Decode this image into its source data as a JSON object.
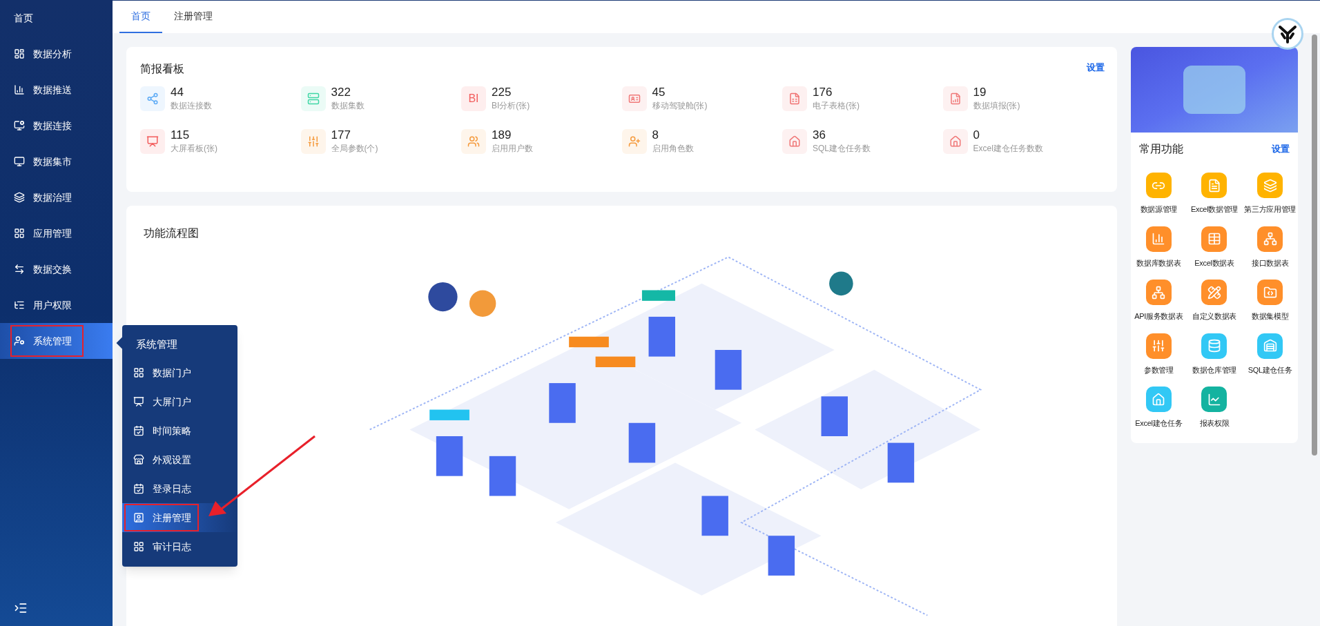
{
  "sidebar": {
    "home": "首页",
    "items": [
      {
        "label": "数据分析",
        "selected": false,
        "highlighted": false
      },
      {
        "label": "数据推送",
        "selected": false,
        "highlighted": false
      },
      {
        "label": "数据连接",
        "selected": false,
        "highlighted": false
      },
      {
        "label": "数据集市",
        "selected": false,
        "highlighted": false
      },
      {
        "label": "数据治理",
        "selected": false,
        "highlighted": false
      },
      {
        "label": "应用管理",
        "selected": false,
        "highlighted": false
      },
      {
        "label": "数据交换",
        "selected": false,
        "highlighted": false
      },
      {
        "label": "用户权限",
        "selected": false,
        "highlighted": false
      },
      {
        "label": "系统管理",
        "selected": true,
        "highlighted": true
      }
    ]
  },
  "submenu": {
    "title": "系统管理",
    "items": [
      {
        "label": "数据门户",
        "selected": false,
        "highlighted": false
      },
      {
        "label": "大屏门户",
        "selected": false,
        "highlighted": false
      },
      {
        "label": "时间策略",
        "selected": false,
        "highlighted": false
      },
      {
        "label": "外观设置",
        "selected": false,
        "highlighted": false
      },
      {
        "label": "登录日志",
        "selected": false,
        "highlighted": false
      },
      {
        "label": "注册管理",
        "selected": true,
        "highlighted": true
      },
      {
        "label": "审计日志",
        "selected": false,
        "highlighted": false
      }
    ]
  },
  "tabs": [
    {
      "label": "首页",
      "selected": true
    },
    {
      "label": "注册管理",
      "selected": false
    }
  ],
  "summary": {
    "title": "简报看板",
    "action": "设置",
    "stats": [
      {
        "value": "44",
        "label": "数据连接数",
        "color": "#5aa9f5"
      },
      {
        "value": "322",
        "label": "数据集数",
        "color": "#3fd6a5"
      },
      {
        "value": "225",
        "label": "BI分析(张)",
        "color": "#f25c5c",
        "icon_text": "BI"
      },
      {
        "value": "45",
        "label": "移动驾驶舱(张)",
        "color": "#f07878"
      },
      {
        "value": "176",
        "label": "电子表格(张)",
        "color": "#f07070"
      },
      {
        "value": "19",
        "label": "数据填报(张)",
        "color": "#f07878"
      },
      {
        "value": "115",
        "label": "大屏看板(张)",
        "color": "#f25c5c"
      },
      {
        "value": "177",
        "label": "全局参数(个)",
        "color": "#f59a3c"
      },
      {
        "value": "189",
        "label": "启用用户数",
        "color": "#f59a3c"
      },
      {
        "value": "8",
        "label": "启用角色数",
        "color": "#f59a3c"
      },
      {
        "value": "36",
        "label": "SQL建仓任务数",
        "color": "#f07878"
      },
      {
        "value": "0",
        "label": "Excel建仓任务数数",
        "color": "#f07878"
      }
    ]
  },
  "flow": {
    "title": "功能流程图"
  },
  "shortcuts": {
    "title": "常用功能",
    "action": "设置",
    "items": [
      {
        "label": "数据源管理",
        "color": "#ffb300"
      },
      {
        "label": "Excel数据管理",
        "color": "#ffb300"
      },
      {
        "label": "第三方应用管理",
        "color": "#ffb300"
      },
      {
        "label": "数据库数据表",
        "color": "#ff8f2a"
      },
      {
        "label": "Excel数据表",
        "color": "#ff8f2a"
      },
      {
        "label": "接口数据表",
        "color": "#ff8f2a"
      },
      {
        "label": "API服务数据表",
        "color": "#ff8f2a"
      },
      {
        "label": "自定义数据表",
        "color": "#ff8f2a"
      },
      {
        "label": "数据集模型",
        "color": "#ff8f2a"
      },
      {
        "label": "参数管理",
        "color": "#ff8f2a"
      },
      {
        "label": "数据仓库管理",
        "color": "#32c8f5"
      },
      {
        "label": "SQL建仓任务",
        "color": "#32c8f5"
      },
      {
        "label": "Excel建仓任务",
        "color": "#32c8f5"
      },
      {
        "label": "报表权限",
        "color": "#14b3a0"
      }
    ]
  }
}
